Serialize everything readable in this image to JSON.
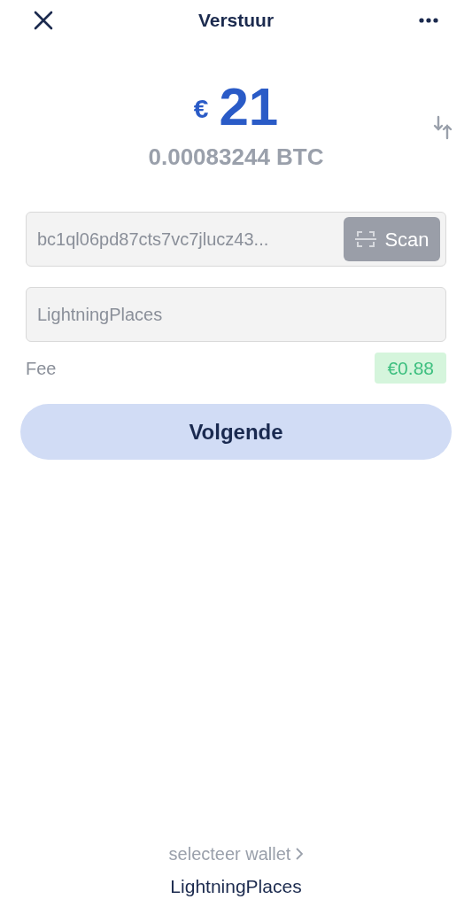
{
  "header": {
    "title": "Verstuur"
  },
  "amount": {
    "currency": "€",
    "value": "21",
    "btc": "0.00083244 BTC"
  },
  "address_field": {
    "value": "bc1ql06pd87cts7vc7jlucz43...",
    "scan_button": "Scan"
  },
  "note_field": {
    "value": "LightningPlaces"
  },
  "fee": {
    "label": "Fee",
    "value": "€0.88"
  },
  "next_button": "Volgende",
  "wallet": {
    "label": "selecteer wallet",
    "name": "LightningPlaces"
  }
}
